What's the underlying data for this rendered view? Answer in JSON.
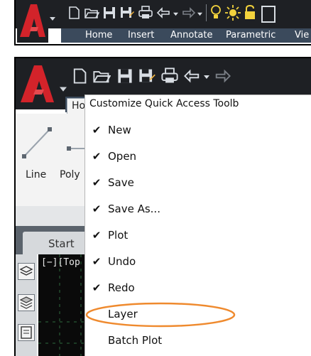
{
  "panel1": {
    "ribbon_tabs": [
      "Home",
      "Insert",
      "Annotate",
      "Parametric",
      "Vie"
    ]
  },
  "panel2": {
    "home_tab_fragment": "Ho",
    "ribbon_tools": [
      "Line",
      "Poly"
    ],
    "start_tab": "Start",
    "viewport_label": "[−][Top",
    "menu": {
      "title": "Customize Quick Access Toolb",
      "items": [
        {
          "label": "New",
          "checked": true
        },
        {
          "label": "Open",
          "checked": true
        },
        {
          "label": "Save",
          "checked": true
        },
        {
          "label": "Save As...",
          "checked": true
        },
        {
          "label": "Plot",
          "checked": true
        },
        {
          "label": "Undo",
          "checked": true
        },
        {
          "label": "Redo",
          "checked": true
        },
        {
          "label": "Layer",
          "checked": false,
          "highlighted": true
        },
        {
          "label": "Batch Plot",
          "checked": false
        }
      ]
    }
  },
  "icons": {
    "app_logo": "autocad-a-logo",
    "new": "new-file-icon",
    "open": "open-folder-icon",
    "save": "save-disk-icon",
    "save_as": "save-as-icon",
    "plot": "printer-icon",
    "undo": "undo-arrow-icon",
    "redo": "redo-arrow-icon"
  },
  "colors": {
    "logo_red": "#d3232a",
    "toolbar_dark": "#1e2024",
    "ribbon_tab_bar": "#3b4a5c",
    "highlight_ellipse": "#ef8a2e",
    "drawing_area": "#0a0a0a",
    "grid": "#2d6a3d"
  }
}
